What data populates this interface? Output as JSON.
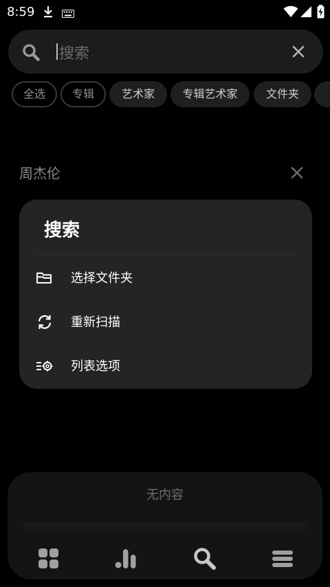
{
  "status_bar": {
    "time": "8:59",
    "icons": [
      "download-icon",
      "keyboard-icon",
      "wifi-icon",
      "signal-icon",
      "battery-charging-icon"
    ]
  },
  "search": {
    "placeholder": "搜索",
    "search_icon": "search-icon",
    "clear_icon": "close-icon"
  },
  "filters": [
    {
      "label": "全选",
      "style": "outline"
    },
    {
      "label": "专辑",
      "style": "outline"
    },
    {
      "label": "艺术家",
      "style": "filled"
    },
    {
      "label": "专辑艺术家",
      "style": "filled"
    },
    {
      "label": "文件夹",
      "style": "filled"
    }
  ],
  "recent": {
    "query": "周杰伦",
    "remove_icon": "close-icon"
  },
  "menu": {
    "title": "搜索",
    "items": [
      {
        "label": "选择文件夹",
        "icon": "folder-icon"
      },
      {
        "label": "重新扫描",
        "icon": "refresh-icon"
      },
      {
        "label": "列表选项",
        "icon": "list-settings-icon"
      }
    ]
  },
  "player": {
    "empty_text": "无内容"
  },
  "bottom_nav": [
    {
      "name": "home",
      "icon": "grid-icon"
    },
    {
      "name": "stats",
      "icon": "bar-chart-icon"
    },
    {
      "name": "search",
      "icon": "search-icon"
    },
    {
      "name": "menu",
      "icon": "hamburger-menu-icon"
    }
  ],
  "colors": {
    "background": "#000000",
    "surface": "#1c1c1c",
    "menu_surface": "#242424",
    "text_primary": "#ffffff",
    "text_secondary": "#8a8a8a"
  }
}
